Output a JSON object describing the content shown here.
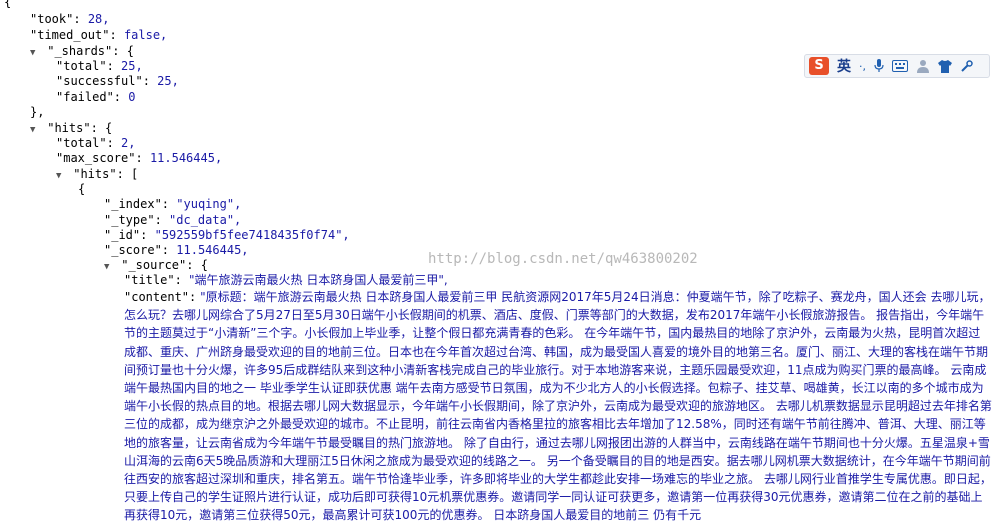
{
  "json_view": {
    "open_brace": "{",
    "took_key": "\"took\":",
    "took_val": "28,",
    "timed_out_key": "\"timed_out\":",
    "timed_out_val": "false,",
    "shards_key": "\"_shards\":",
    "shards_open": "{",
    "shards_total_key": "\"total\":",
    "shards_total_val": "25,",
    "shards_successful_key": "\"successful\":",
    "shards_successful_val": "25,",
    "shards_failed_key": "\"failed\":",
    "shards_failed_val": "0",
    "shards_close": "},",
    "hits_key": "\"hits\":",
    "hits_open": "{",
    "hits_total_key": "\"total\":",
    "hits_total_val": "2,",
    "max_score_key": "\"max_score\":",
    "max_score_val": "11.546445,",
    "hits_array_key": "\"hits\":",
    "hits_array_open": "[",
    "item_open": "{",
    "index_key": "\"_index\":",
    "index_val": "\"yuqing\",",
    "type_key": "\"_type\":",
    "type_val": "\"dc_data\",",
    "id_key": "\"_id\":",
    "id_val": "\"592559bf5fee7418435f0f74\",",
    "score_key": "\"_score\":",
    "score_val": "11.546445,",
    "source_key": "\"_source\":",
    "source_open": "{",
    "title_key": "\"title\":",
    "title_val": "\"端午旅游云南最火热 日本跻身国人最爱前三甲\",",
    "content_key": "\"content\":",
    "content_val": "\"原标题：端午旅游云南最火热 日本跻身国人最爱前三甲        民航资源网2017年5月24日消息：仲夏端午节，除了吃粽子、赛龙舟，国人还会 去哪儿玩，怎么玩？去哪儿网综合了5月27日至5月30日端午小长假期间的机票、酒店、度假、门票等部门的大数据，发布2017年端午小长假旅游报告。        报告指出，今年端午节的主题莫过于“小清新”三个字。小长假加上毕业季，让整个假日都充满青春的色彩。        在今年端午节，国内最热目的地除了京沪外，云南最为火热，昆明首次超过成都、重庆、广州跻身最受欢迎的目的地前三位。日本也在今年首次超过台湾、韩国，成为最受国人喜爱的境外目的地第三名。厦门、丽江、大理的客栈在端午节期间预订量也十分火爆，许多95后成群结队来到这种小清新客栈完成自己的毕业旅行。对于本地游客来说，主题乐园最受欢迎，11点成为购买门票的最高峰。        云南成端午最热国内目的地之一 毕业季学生认证即获优惠        端午去南方感受节日氛围，成为不少北方人的小长假选择。包粽子、挂艾草、喝雄黄，长江以南的多个城市成为端午小长假的热点目的地。根据去哪儿网大数据显示，今年端午小长假期间，除了京沪外，云南成为最受欢迎的旅游地区。        去哪儿机票数据显示昆明超过去年排名第三位的成都，成为继京沪之外最受欢迎的城市。不止昆明，前往云南省内香格里拉的旅客相比去年增加了12.58%，同时还有端午节前往腾冲、普洱、大理、丽江等地的旅客量，让云南省成为今年端午节最受瞩目的热门旅游地。        除了自由行，通过去哪儿网报团出游的人群当中，云南线路在端午节期间也十分火爆。五星温泉+雪山洱海的云南6天5晚品质游和大理丽江5日休闲之旅成为最受欢迎的线路之一。        另一个备受瞩目的目的地是西安。据去哪儿网机票大数据统计，在今年端午节期间前往西安的旅客超过深圳和重庆，排名第五。端午节恰逢毕业季，许多即将毕业的大学生都趁此安排一场难忘的毕业之旅。        去哪儿网行业首推学生专属优惠。即日起，只要上传自己的学生证照片进行认证，成功后即可获得10元机票优惠券。邀请同学一同认证可获更多，邀请第一位再获得30元优惠券，邀请第二位在之前的基础上再获得10元，邀请第三位获得50元，最高累计可获100元的优惠券。        日本跻身国人最爱目的地前三 仍有千元"
  },
  "watermark": "http://blog.csdn.net/qw463800202",
  "ime_toolbar": {
    "logo": "S",
    "mode_label": "英",
    "punct_label": "·,",
    "icons": [
      "microphone-icon",
      "keyboard-icon",
      "user-icon",
      "shirt-icon",
      "tools-icon"
    ]
  },
  "colors": {
    "value": "#1a1aa6",
    "key": "#000000",
    "ime_logo": "#e8502a"
  }
}
